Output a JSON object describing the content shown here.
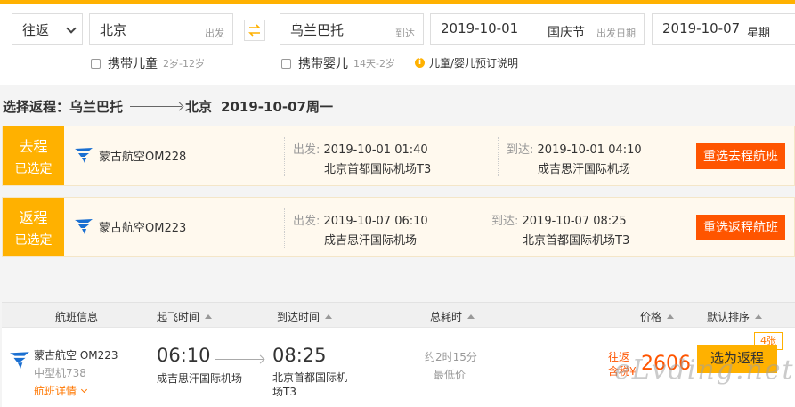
{
  "search": {
    "trip_type": "往返",
    "from_city": "北京",
    "from_hint": "出发",
    "to_city": "乌兰巴托",
    "to_hint": "到达",
    "depart_date": "2019-10-01",
    "depart_festival": "国庆节",
    "depart_hint": "出发日期",
    "return_date": "2019-10-07",
    "return_week": "星期",
    "child_label": "携带儿童",
    "child_age": "2岁-12岁",
    "infant_label": "携带婴儿",
    "infant_age": "14天-2岁",
    "info_text": "儿童/婴儿预订说明"
  },
  "selection_title": {
    "prefix": "选择返程：乌兰巴托",
    "dest": "北京",
    "date": "2019-10-07周一"
  },
  "legs": [
    {
      "tag_big": "去程",
      "tag_small": "已选定",
      "airline": "蒙古航空OM228",
      "dep_label": "出发:",
      "dep_time": "2019-10-01 01:40",
      "dep_airport": "北京首都国际机场T3",
      "arr_label": "到达:",
      "arr_time": "2019-10-01 04:10",
      "arr_airport": "成吉思汗国际机场",
      "button": "重选去程航班"
    },
    {
      "tag_big": "返程",
      "tag_small": "已选定",
      "airline": "蒙古航空OM223",
      "dep_label": "出发:",
      "dep_time": "2019-10-07 06:10",
      "dep_airport": "成吉思汗国际机场",
      "arr_label": "到达:",
      "arr_time": "2019-10-07 08:25",
      "arr_airport": "北京首都国际机场T3",
      "button": "重选返程航班"
    }
  ],
  "table_header": {
    "info": "航班信息",
    "dep": "起飞时间",
    "arr": "到达时间",
    "dur": "总耗时",
    "price": "价格",
    "sort": "默认排序"
  },
  "flight_row": {
    "airline": "蒙古航空",
    "flight_no": "OM223",
    "model": "中型机738",
    "detail": "航班详情",
    "dep_time": "06:10",
    "dep_airport": "成吉思汗国际机场",
    "arr_time": "08:25",
    "arr_airport": "北京首都国际机场T3",
    "duration": "约2时15分",
    "lowest": "最低价",
    "price_note1": "往返",
    "price_note2": "含税¥",
    "price": "2606",
    "seats": "4张",
    "select_button": "选为返程"
  },
  "watermark": "eLvding.net",
  "colors": {
    "accent": "#ffb100",
    "action": "#ff5500",
    "leg_bg": "#fff9ee",
    "airline_logo": "#1a6fd1"
  }
}
